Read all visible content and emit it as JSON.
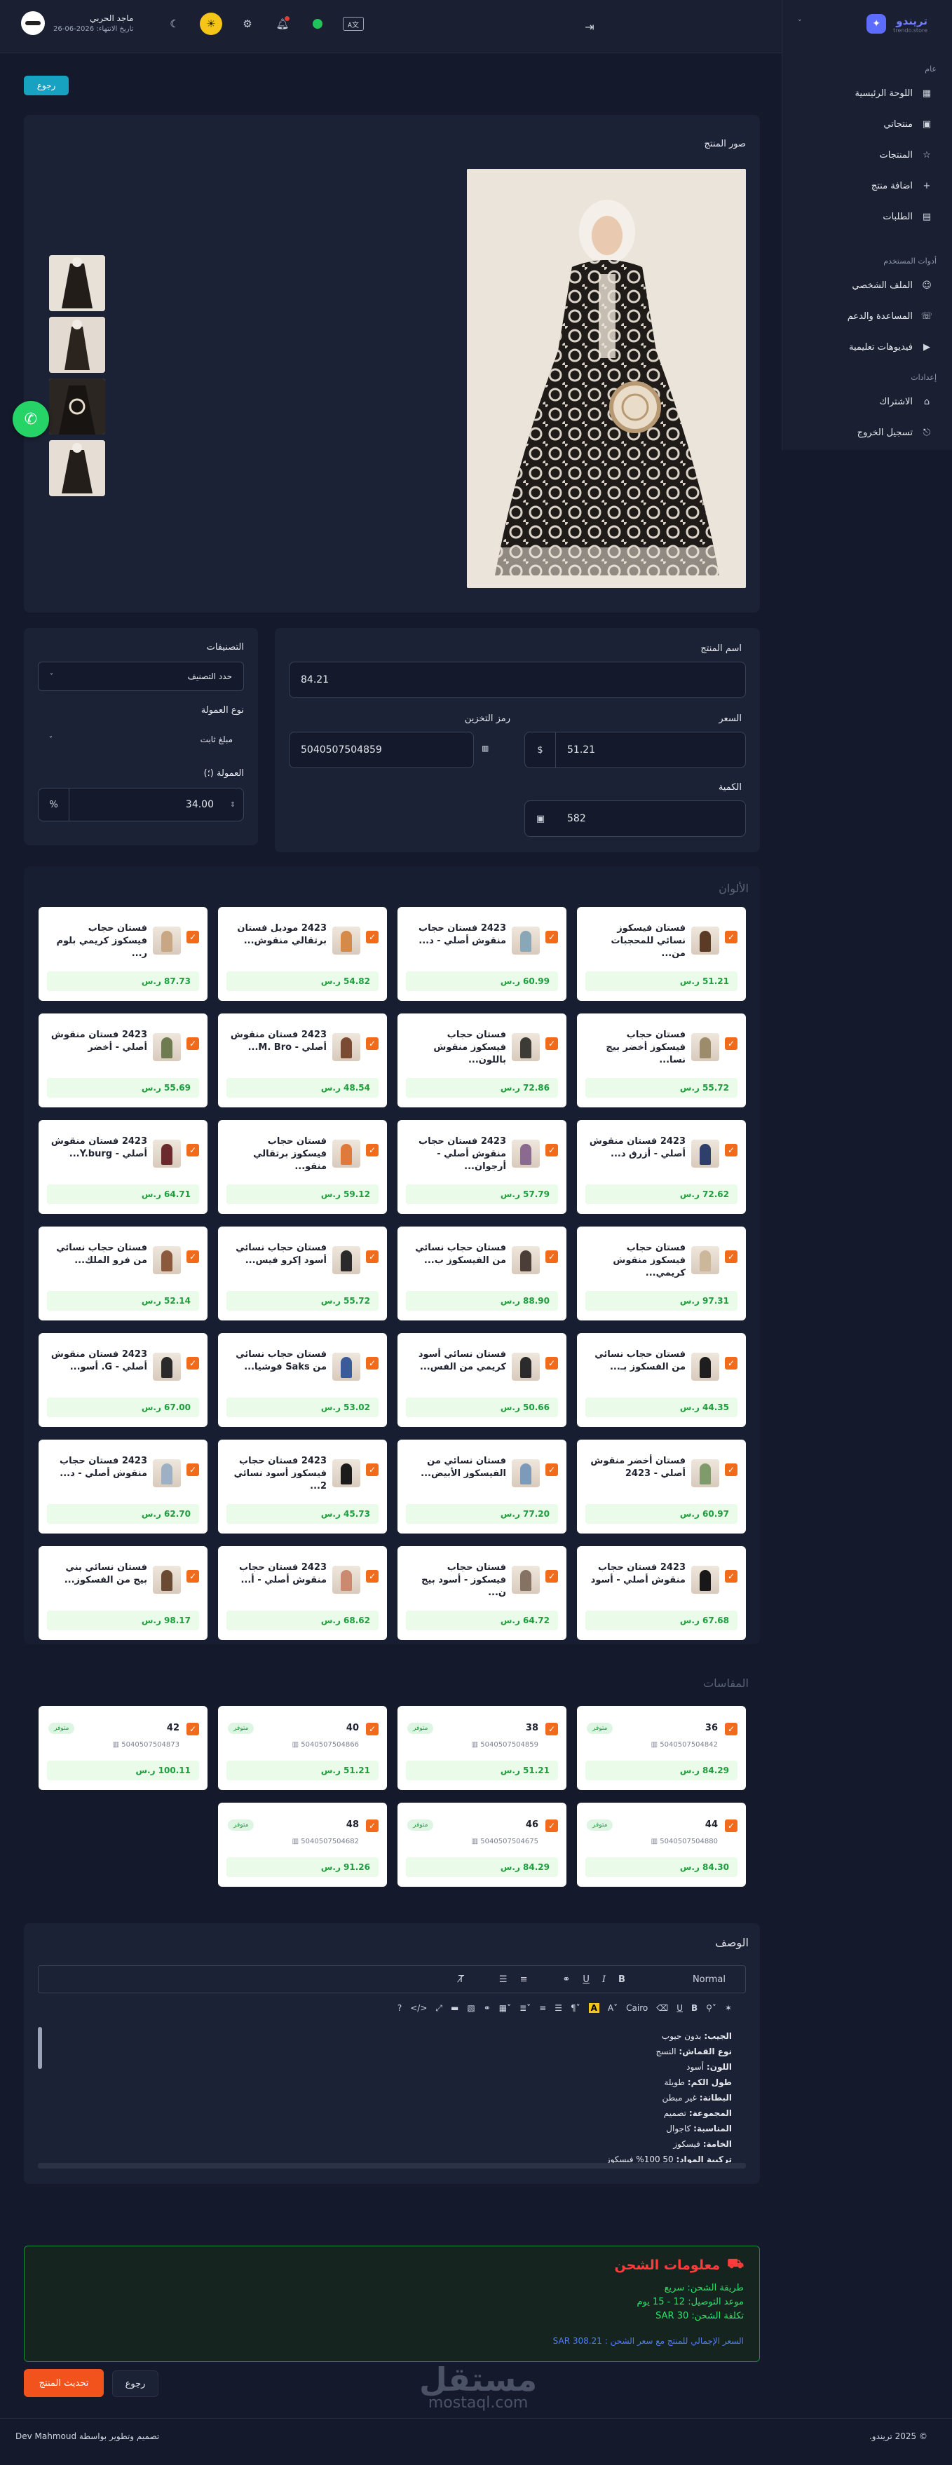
{
  "header": {
    "user_name": "ماجد الحربي",
    "expiry": "تاريخ الانتهاء: 2026-06-26",
    "lang_badge": "A文",
    "collapse_icon": "collapse-right-icon"
  },
  "brand": {
    "name": "تريندو",
    "tagline": "trendo.store"
  },
  "sidebar": {
    "group_general": "عام",
    "items_general": [
      {
        "label": "اللوحة الرئيسية",
        "icon": "dashboard-icon"
      },
      {
        "label": "منتجاتي",
        "icon": "box-icon"
      },
      {
        "label": "المنتجات",
        "icon": "star-icon"
      },
      {
        "label": "اضافة منتج",
        "icon": "plus-icon"
      },
      {
        "label": "الطلبات",
        "icon": "orders-icon"
      }
    ],
    "group_user": "أدوات المستخدم",
    "items_user": [
      {
        "label": "الملف الشخصي",
        "icon": "user-icon"
      },
      {
        "label": "المساعدة والدعم",
        "icon": "support-icon"
      },
      {
        "label": "فيديوهات تعليمية",
        "icon": "video-icon"
      }
    ],
    "group_settings": "إعدادات",
    "items_settings": [
      {
        "label": "الاشتراك",
        "icon": "subscription-icon"
      },
      {
        "label": "تسجيل الخروج",
        "icon": "logout-icon"
      }
    ]
  },
  "back_label": "رجوع",
  "images_section": {
    "title": "صور المنتج"
  },
  "form": {
    "name_label": "اسم المنتج",
    "name_value": "84.21",
    "price_label": "السعر",
    "price_value": "51.21",
    "price_addon": "$",
    "sku_label": "رمز التخزين",
    "sku_value": "5040507504859",
    "qty_label": "الكمية",
    "qty_value": "582",
    "categories_label": "التصنيفات",
    "categories_placeholder": "حدد التصنيف",
    "commission_type_label": "نوع العمولة",
    "commission_type_value": "مبلغ ثابت",
    "commission_label": "العمولة (؛)",
    "commission_value": "34.00",
    "commission_addon": "%"
  },
  "colors_title": "الألوان",
  "colors": [
    {
      "name": "فستان فيسكوز نسائي للمحجبات من...",
      "price": "51.21 ر.س",
      "tone": "#5b3a26"
    },
    {
      "name": "2423 فستان حجاب منقوش أصلي - د...",
      "price": "60.99 ر.س",
      "tone": "#8aa7b8"
    },
    {
      "name": "2423 موديل فستان برتقالي منقوش...",
      "price": "54.82 ر.س",
      "tone": "#d58a4a"
    },
    {
      "name": "فستان حجاب فيسكوز كريمي بلوم ر...",
      "price": "87.73 ر.س",
      "tone": "#c8a784"
    },
    {
      "name": "فستان حجاب فيسكوز أخضر بيج نسا...",
      "price": "55.72 ر.س",
      "tone": "#9d8c6b"
    },
    {
      "name": "فستان حجاب فيسكوز منقوش باللون...",
      "price": "72.86 ر.س",
      "tone": "#3c3b36"
    },
    {
      "name": "2423 فستان منقوش أصلي - M. Bro...",
      "price": "48.54 ر.س",
      "tone": "#7a4a33"
    },
    {
      "name": "2423 فستان منقوش أصلي - أخضر",
      "price": "55.69 ر.س",
      "tone": "#6e7a4f"
    },
    {
      "name": "2423 فستان منقوش أصلي - أزرق د...",
      "price": "72.62 ر.س",
      "tone": "#2e3f6b"
    },
    {
      "name": "2423 فستان حجاب منقوش أصلي - أرجوان...",
      "price": "57.79 ر.س",
      "tone": "#8a6a8e"
    },
    {
      "name": "فستان حجاب فيسكوز برتقالي منقو...",
      "price": "59.12 ر.س",
      "tone": "#e07a3b"
    },
    {
      "name": "2423 فستان منقوش أصلي - Y.burg...",
      "price": "64.71 ر.س",
      "tone": "#6b2b2e"
    },
    {
      "name": "فستان حجاب فيسكوز منقوش كريمي...",
      "price": "97.31 ر.س",
      "tone": "#cdb79a"
    },
    {
      "name": "فستان حجاب نسائي من الفيسكوز ب...",
      "price": "88.90 ر.س",
      "tone": "#4b3e39"
    },
    {
      "name": "فستان حجاب نسائي أسود إكرو فيس...",
      "price": "55.72 ر.س",
      "tone": "#2a2a2a"
    },
    {
      "name": "فستان حجاب نسائي من فرو الملك...",
      "price": "52.14 ر.س",
      "tone": "#8b5a3c"
    },
    {
      "name": "فستان حجاب نسائي من الفسكوز بـ...",
      "price": "44.35 ر.س",
      "tone": "#1e1e1e"
    },
    {
      "name": "فستان نسائي أسود كريمي من الفس...",
      "price": "50.66 ر.س",
      "tone": "#2b2b2b"
    },
    {
      "name": "فستان حجاب نسائي من Saks فوشيا...",
      "price": "53.02 ر.س",
      "tone": "#3a5a9a"
    },
    {
      "name": "2423 فستان منقوش أصلي - G. أسو...",
      "price": "67.00 ر.س",
      "tone": "#2a2a2a"
    },
    {
      "name": "فستان أخضر منقوش أصلي - 2423",
      "price": "60.97 ر.س",
      "tone": "#7f9a6b"
    },
    {
      "name": "فستان نسائي من الفيسكوز الأبيض...",
      "price": "77.20 ر.س",
      "tone": "#7d9ab9"
    },
    {
      "name": "2423 فستان حجاب فيسكوز أسود نسائي 2...",
      "price": "45.73 ر.س",
      "tone": "#1b1b1b"
    },
    {
      "name": "2423 فستان حجاب منقوش أصلي - د...",
      "price": "62.70 ر.س",
      "tone": "#9eb1c4"
    },
    {
      "name": "2423 فستان حجاب منقوش أصلي - أسود",
      "price": "67.68 ر.س",
      "tone": "#181818"
    },
    {
      "name": "فستان حجاب فيسكوز - أسود بيج ن...",
      "price": "64.72 ر.س",
      "tone": "#867262"
    },
    {
      "name": "2423 فستان حجاب منقوش أصلي - أ...",
      "price": "68.62 ر.س",
      "tone": "#c98a6f"
    },
    {
      "name": "فستان نسائي بني بيج من الفسكوز...",
      "price": "98.17 ر.س",
      "tone": "#6b4a33"
    }
  ],
  "sizes_title": "المقاسات",
  "sizes": [
    {
      "name": "36",
      "sku": "5040507504842",
      "price": "84.29 ر.س",
      "badge": "متوفر"
    },
    {
      "name": "38",
      "sku": "5040507504859",
      "price": "51.21 ر.س",
      "badge": "متوفر"
    },
    {
      "name": "40",
      "sku": "5040507504866",
      "price": "51.21 ر.س",
      "badge": "متوفر"
    },
    {
      "name": "42",
      "sku": "5040507504873",
      "price": "100.11 ر.س",
      "badge": "متوفر"
    },
    {
      "name": "44",
      "sku": "5040507504880",
      "price": "84.30 ر.س",
      "badge": "متوفر"
    },
    {
      "name": "46",
      "sku": "5040507504675",
      "price": "84.29 ر.س",
      "badge": "متوفر"
    },
    {
      "name": "48",
      "sku": "5040507504682",
      "price": "91.26 ر.س",
      "badge": "متوفر"
    }
  ],
  "description": {
    "title": "الوصف",
    "format_select": "Normal",
    "font_select": "Cairo",
    "lines": [
      {
        "k": "الجيب:",
        "v": "بدون جيوب"
      },
      {
        "k": "نوع القماش:",
        "v": "النسج"
      },
      {
        "k": "اللون:",
        "v": "أسود"
      },
      {
        "k": "طول الكم:",
        "v": "طويلة"
      },
      {
        "k": "البطانة:",
        "v": "غير مبطن"
      },
      {
        "k": "المجموعة:",
        "v": "تصميم"
      },
      {
        "k": "المناسبة:",
        "v": "كاجوال"
      },
      {
        "k": "الخامة:",
        "v": "فيسكوز"
      },
      {
        "k": "تركيبة المواد:",
        "v": "50 100% فيسكوز"
      }
    ]
  },
  "shipping": {
    "title": "معلومات الشحن",
    "method": "طريقة الشحن: سريع",
    "time": "موعد التوصيل: 12 - 15 يوم",
    "cost": "تكلفة الشحن: 30 SAR",
    "total": "السعر الإجمالي للمنتج مع سعر الشحن : 308.21 SAR"
  },
  "buttons": {
    "update": "تحديث المنتج",
    "back": "رجوع"
  },
  "watermark": {
    "ar": "مستقل",
    "en": "mostaql.com"
  },
  "footer": {
    "copyright": "© 2025 تريندو.",
    "credit": "تصميم وتطوير بواسطة Dev Mahmoud"
  },
  "colors_theme": {
    "accent_orange": "#f2521b",
    "accent_teal": "#17a2c2",
    "price_green": "#1f9d3e"
  }
}
